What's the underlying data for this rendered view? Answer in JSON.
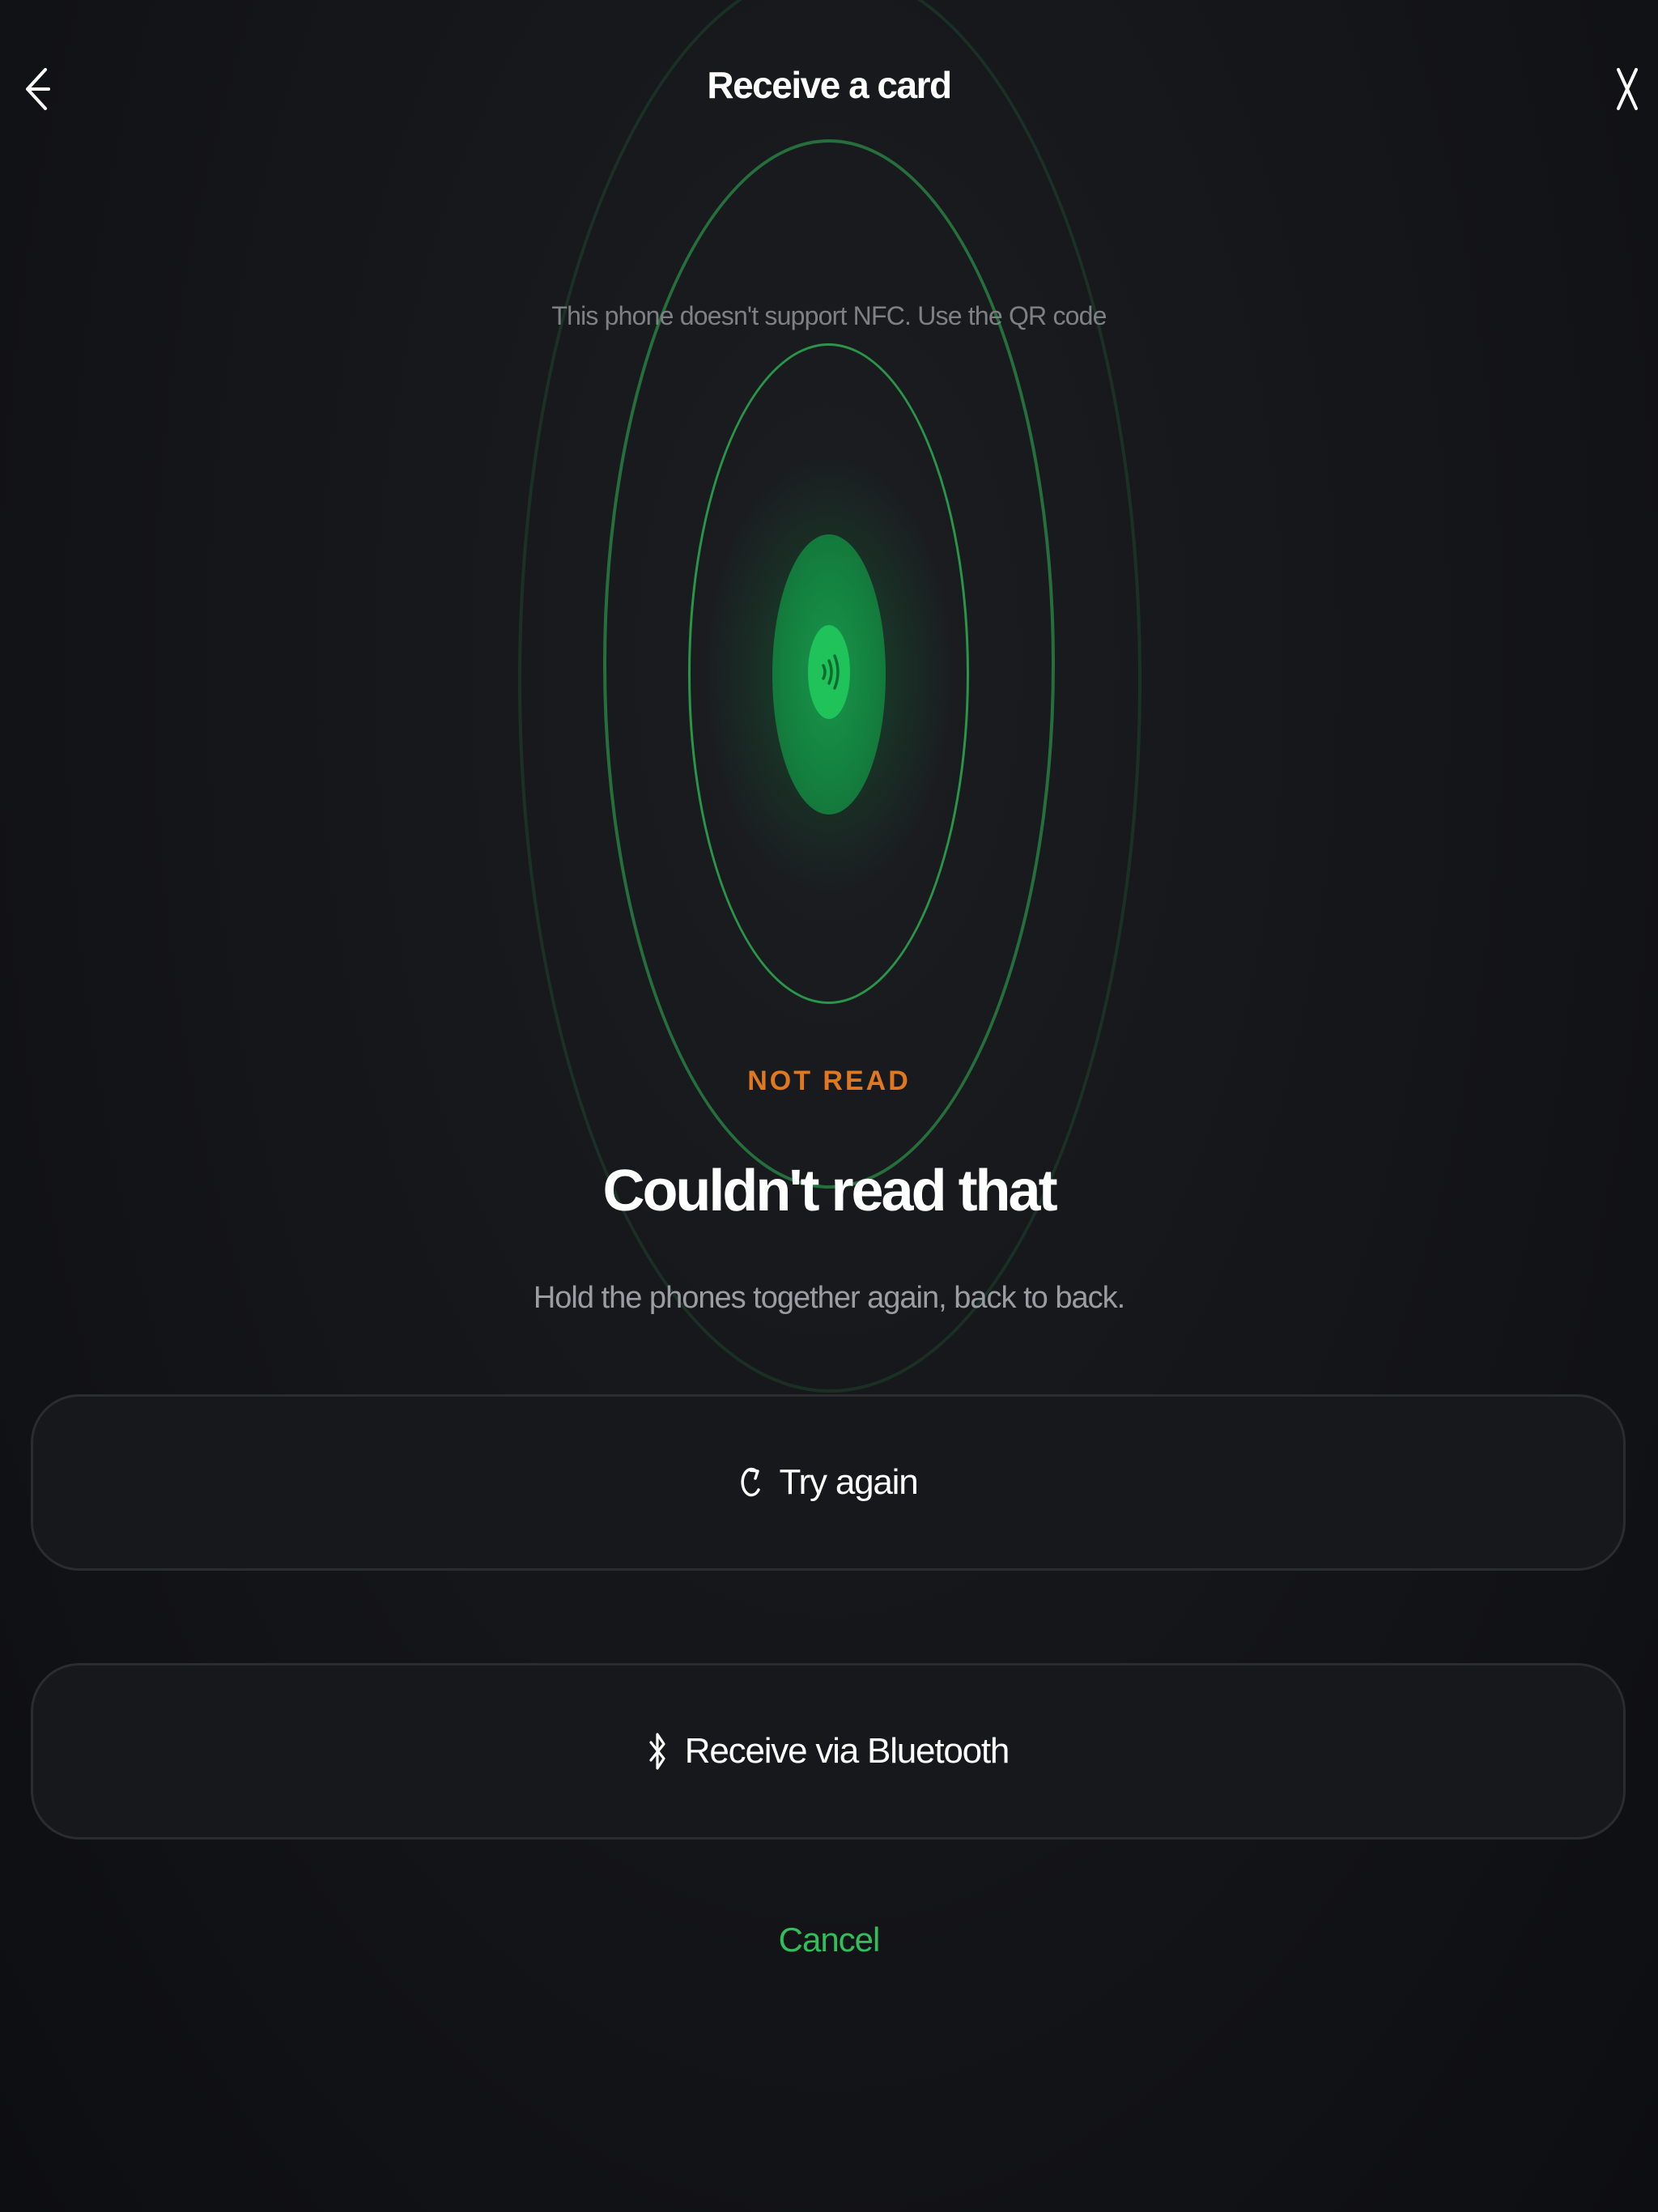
{
  "header": {
    "title": "Receive a card",
    "back_icon": "arrow-left-icon",
    "close_icon": "close-icon"
  },
  "nfc": {
    "note": "This phone doesn't support NFC. Use the QR code",
    "icon": "nfc-signal-icon"
  },
  "result": {
    "status": "NOT READ",
    "headline": "Couldn't read that",
    "message": "Hold the phones together again, back to back."
  },
  "actions": {
    "try_again": {
      "label": "Try again",
      "icon": "refresh-icon"
    },
    "bluetooth": {
      "label": "Receive via Bluetooth",
      "icon": "bluetooth-icon"
    },
    "cancel": "Cancel"
  },
  "colors": {
    "accent_green": "#1fc35a",
    "status_orange": "#e0781f",
    "background": "#141519"
  }
}
